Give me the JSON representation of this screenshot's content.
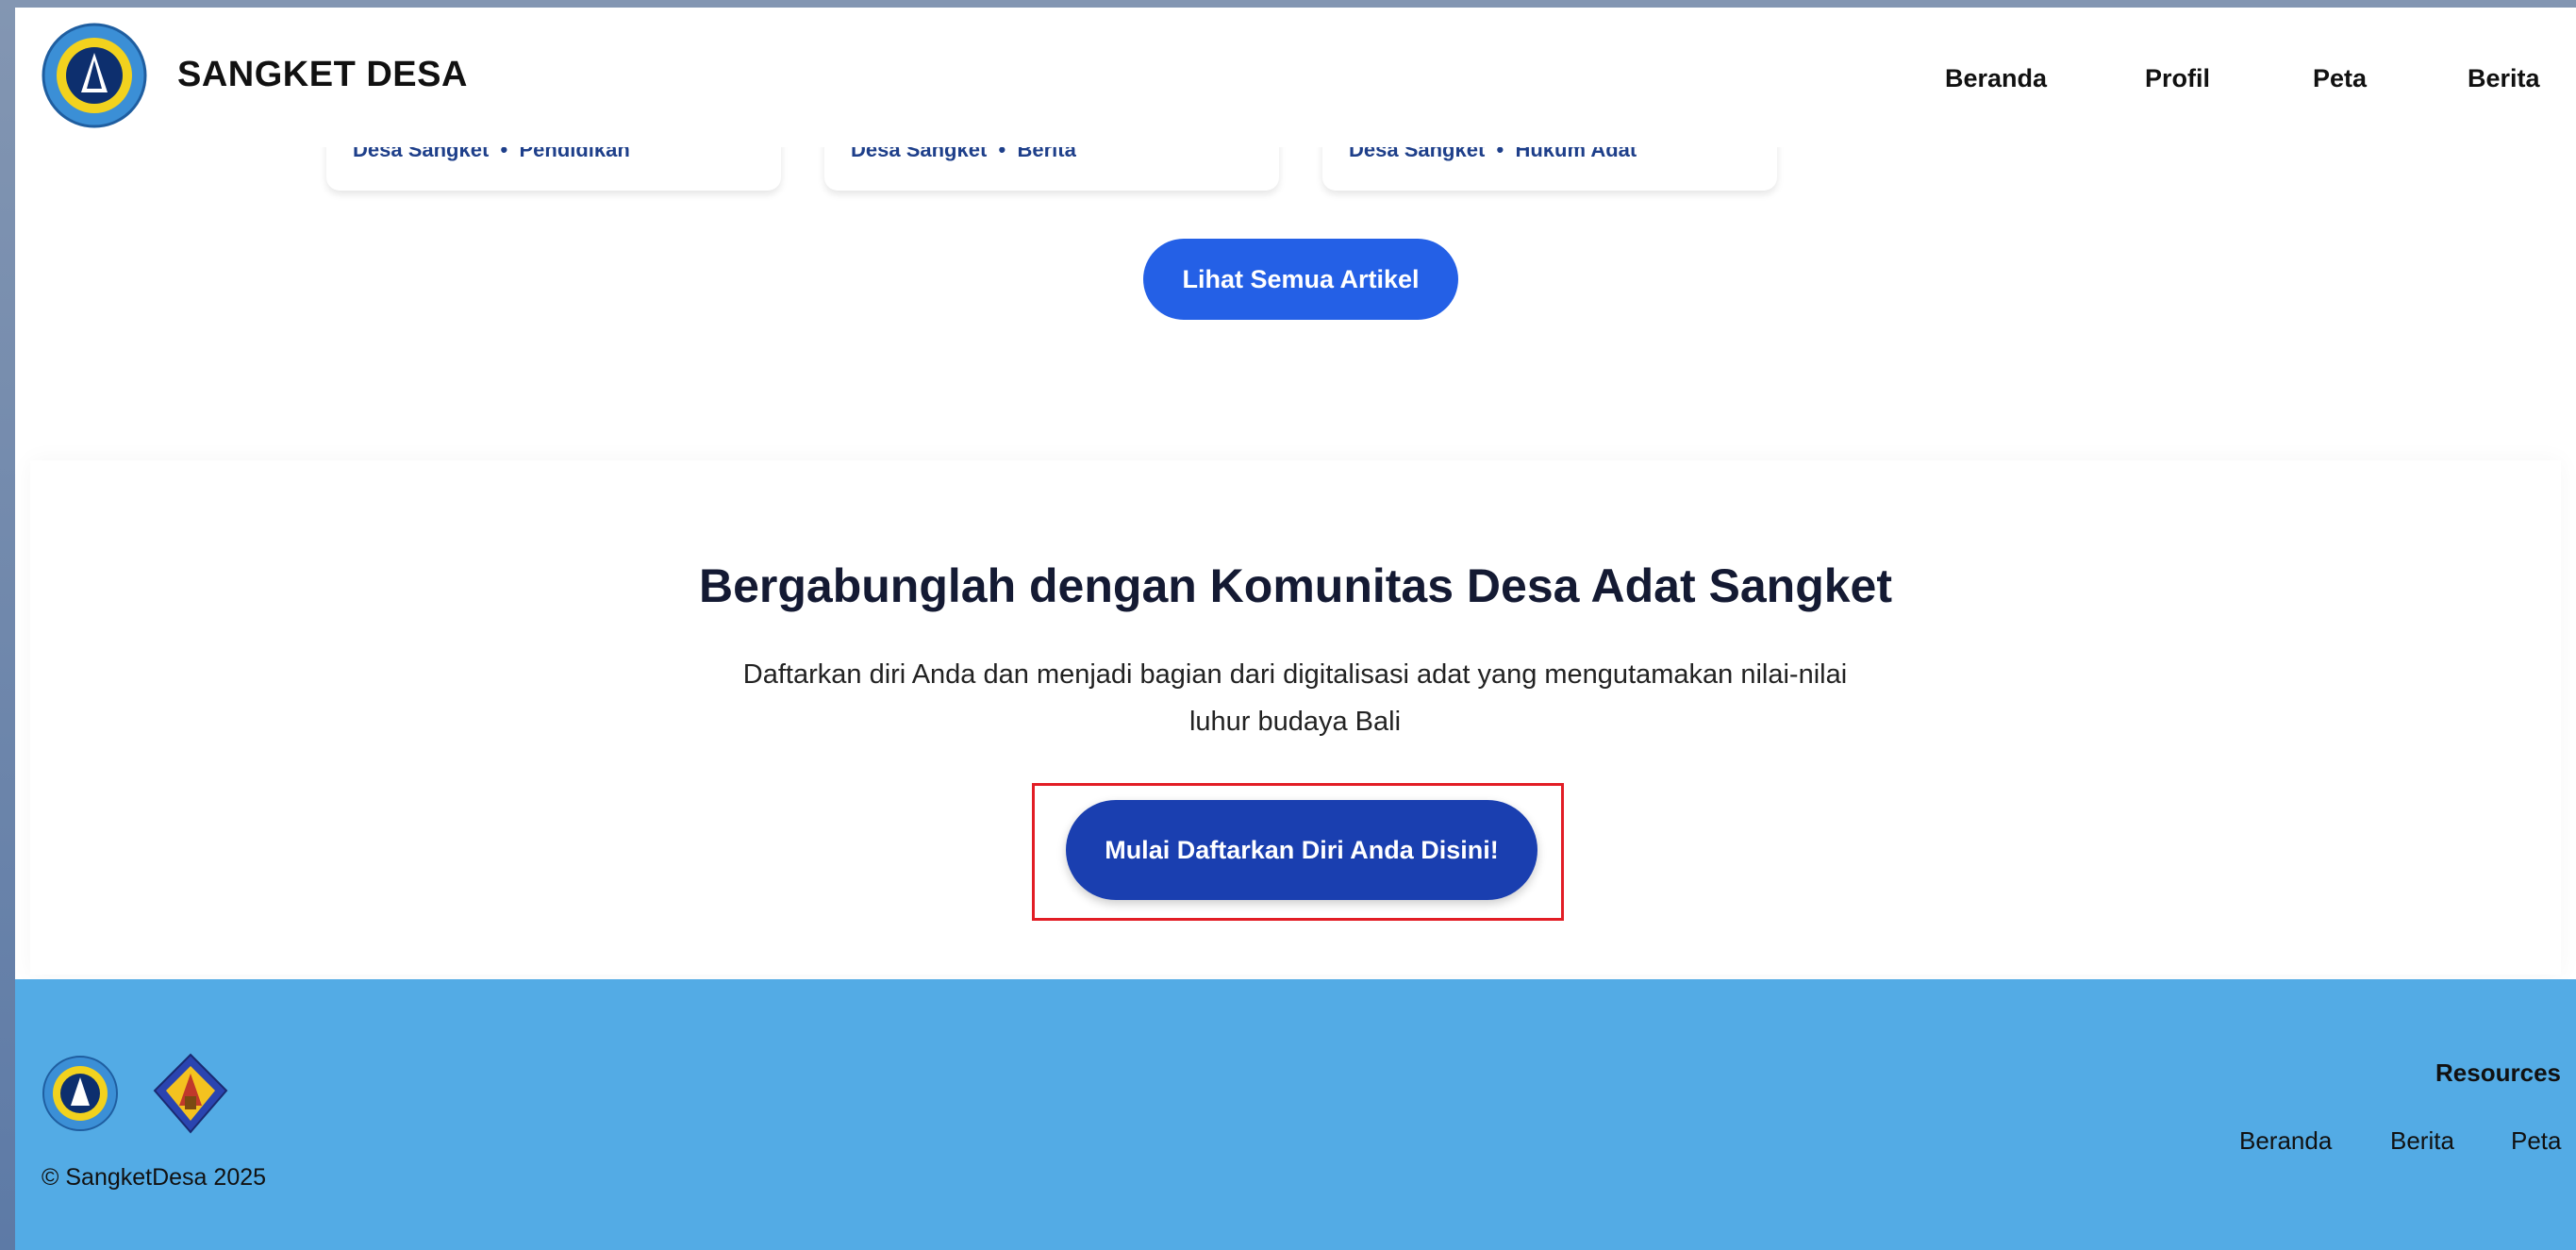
{
  "navbar": {
    "brand": "SANGKET DESA",
    "items": [
      {
        "label": "Beranda"
      },
      {
        "label": "Profil"
      },
      {
        "label": "Peta"
      },
      {
        "label": "Berita"
      }
    ]
  },
  "articles": [
    {
      "source": "Desa Sangket",
      "separator": "•",
      "category": "Pendidikan"
    },
    {
      "source": "Desa Sangket",
      "separator": "•",
      "category": "Berita"
    },
    {
      "source": "Desa Sangket",
      "separator": "•",
      "category": "Hukum Adat"
    }
  ],
  "see_all_label": "Lihat Semua Artikel",
  "join": {
    "title": "Bergabunglah dengan Komunitas Desa Adat Sangket",
    "description": "Daftarkan diri Anda dan menjadi bagian dari digitalisasi adat yang mengutamakan nilai-nilai luhur budaya Bali",
    "button_label": "Mulai Daftarkan Diri Anda Disini!"
  },
  "footer": {
    "copyright": "© SangketDesa 2025",
    "resources_title": "Resources",
    "links": [
      {
        "label": "Beranda"
      },
      {
        "label": "Berita"
      },
      {
        "label": "Peta"
      }
    ]
  },
  "colors": {
    "primary_button": "#2460e6",
    "cta_button": "#1a3fb0",
    "footer_bg": "#53abe5",
    "highlight_border": "#e21d25"
  }
}
